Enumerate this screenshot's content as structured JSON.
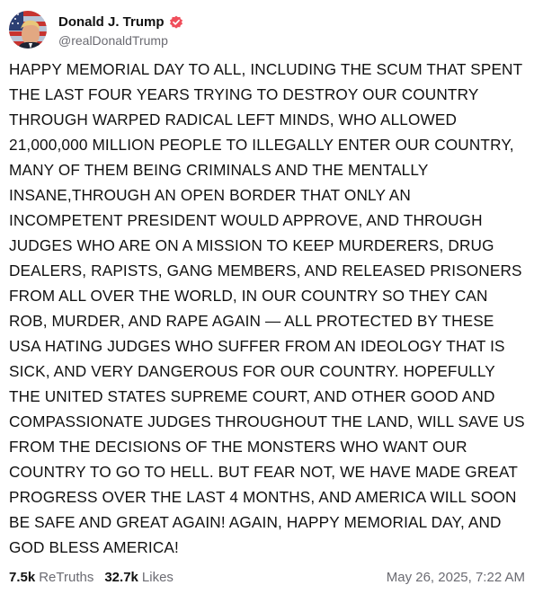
{
  "author": {
    "display_name": "Donald J. Trump",
    "handle": "@realDonaldTrump",
    "verified_icon": "verified-badge-icon",
    "badge_color": "#f04e5b"
  },
  "post": {
    "text": "HAPPY MEMORIAL DAY TO ALL, INCLUDING THE SCUM THAT SPENT THE LAST FOUR YEARS TRYING TO DESTROY OUR COUNTRY THROUGH WARPED RADICAL LEFT MINDS, WHO ALLOWED 21,000,000 MILLION PEOPLE TO ILLEGALLY ENTER OUR COUNTRY, MANY OF THEM BEING CRIMINALS AND THE MENTALLY INSANE,THROUGH AN OPEN BORDER THAT ONLY AN INCOMPETENT PRESIDENT WOULD APPROVE, AND THROUGH JUDGES WHO ARE ON A MISSION TO KEEP MURDERERS, DRUG DEALERS, RAPISTS, GANG MEMBERS, AND RELEASED PRISONERS FROM ALL OVER THE WORLD, IN OUR COUNTRY SO THEY CAN ROB, MURDER, AND RAPE AGAIN — ALL PROTECTED BY THESE USA HATING JUDGES WHO SUFFER FROM AN IDEOLOGY THAT IS SICK, AND VERY DANGEROUS FOR OUR COUNTRY. HOPEFULLY THE UNITED STATES SUPREME COURT, AND OTHER GOOD AND COMPASSIONATE JUDGES THROUGHOUT THE LAND, WILL SAVE US FROM THE DECISIONS OF THE MONSTERS WHO WANT OUR COUNTRY TO GO TO HELL. BUT FEAR NOT, WE HAVE MADE GREAT PROGRESS OVER THE LAST 4 MONTHS, AND AMERICA WILL SOON BE SAFE AND GREAT AGAIN! AGAIN, HAPPY MEMORIAL DAY, AND GOD BLESS AMERICA!"
  },
  "stats": {
    "retruths_count": "7.5k",
    "retruths_label": "ReTruths",
    "likes_count": "32.7k",
    "likes_label": "Likes"
  },
  "timestamp": "May 26, 2025, 7:22 AM"
}
